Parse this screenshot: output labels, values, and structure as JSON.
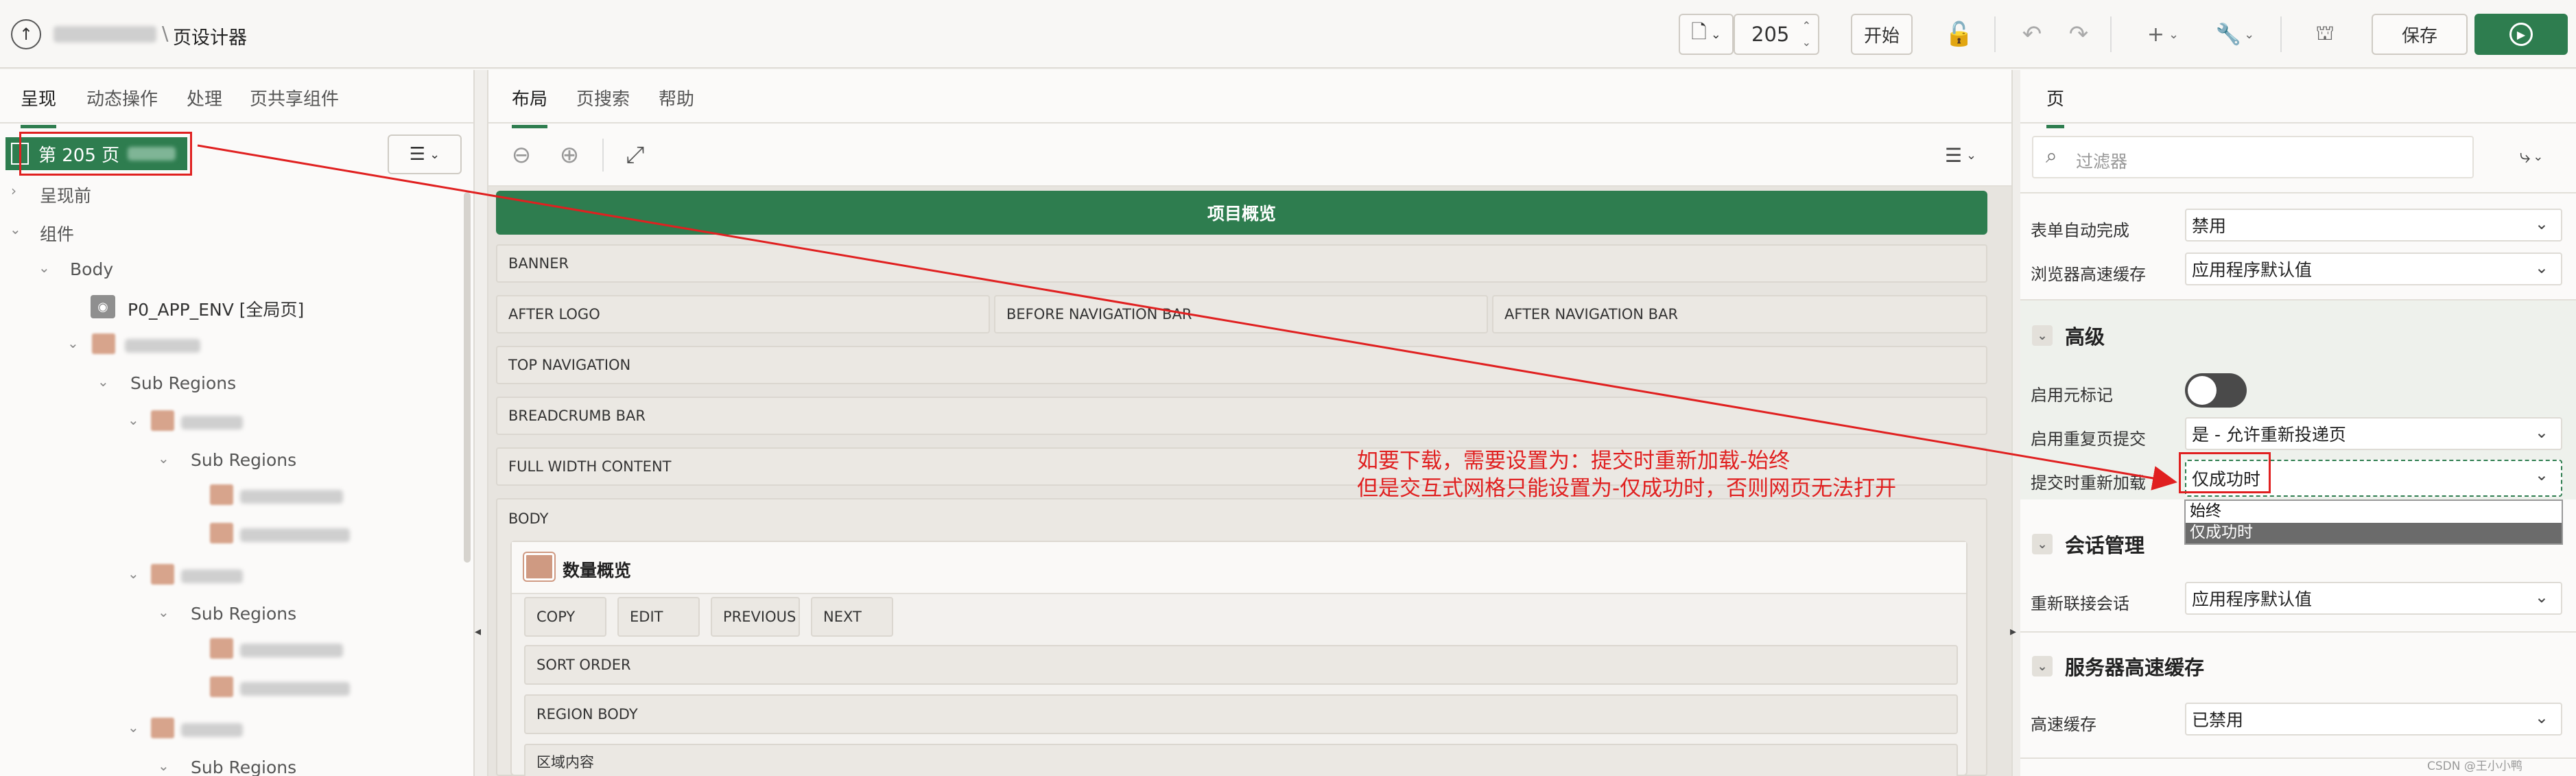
{
  "header": {
    "breadcrumb_blur": "",
    "breadcrumb_sep": "\\",
    "title": "页设计器",
    "page_number": "205",
    "go_label": "开始",
    "save_label": "保存"
  },
  "left": {
    "tabs": [
      "呈现",
      "动态操作",
      "处理",
      "页共享组件"
    ],
    "page_node": "第 205 页",
    "tree": {
      "pre_render": "呈现前",
      "components": "组件",
      "body": "Body",
      "app_env": "P0_APP_ENV [全局页]",
      "sub_regions": "Sub Regions"
    }
  },
  "center": {
    "tabs": [
      "布局",
      "页搜索",
      "帮助"
    ],
    "top_region": "项目概览",
    "positions": {
      "banner": "BANNER",
      "after_logo": "AFTER LOGO",
      "before_nav": "BEFORE NAVIGATION BAR",
      "after_nav": "AFTER NAVIGATION BAR",
      "top_nav": "TOP NAVIGATION",
      "breadcrumb": "BREADCRUMB BAR",
      "full_width": "FULL WIDTH CONTENT",
      "body": "BODY"
    },
    "card": {
      "title": "数量概览",
      "buttons": [
        "COPY",
        "EDIT",
        "PREVIOUS",
        "NEXT"
      ],
      "sort_order": "SORT ORDER",
      "region_body": "REGION BODY",
      "region_content": "区域内容"
    },
    "annotation": {
      "line1": "如要下载，需要设置为：提交时重新加载-始终",
      "line2": "但是交互式网格只能设置为-仅成功时，否则网页无法打开",
      "color": "#e02020"
    }
  },
  "right": {
    "tab": "页",
    "filter_placeholder": "过滤器",
    "rows": {
      "form_autocomplete": {
        "label": "表单自动完成",
        "value": "禁用"
      },
      "browser_cache": {
        "label": "浏览器高速缓存",
        "value": "应用程序默认值"
      }
    },
    "advanced": {
      "title": "高级",
      "enable_meta": "启用元标记",
      "dup_submit": {
        "label": "启用重复页提交",
        "value": "是 - 允许重新投递页"
      },
      "reload_on_submit": {
        "label": "提交时重新加载",
        "value": "仅成功时",
        "options": [
          "始终",
          "仅成功时"
        ]
      }
    },
    "session": {
      "title": "会话管理",
      "rejoin": {
        "label": "重新联接会话",
        "value": "应用程序默认值"
      }
    },
    "server_cache": {
      "title": "服务器高速缓存",
      "cache": {
        "label": "高速缓存",
        "value": "已禁用"
      }
    }
  },
  "watermark": "CSDN @王小小鸭",
  "colors": {
    "accent": "#2e7d4f",
    "annotation": "#e02020"
  }
}
